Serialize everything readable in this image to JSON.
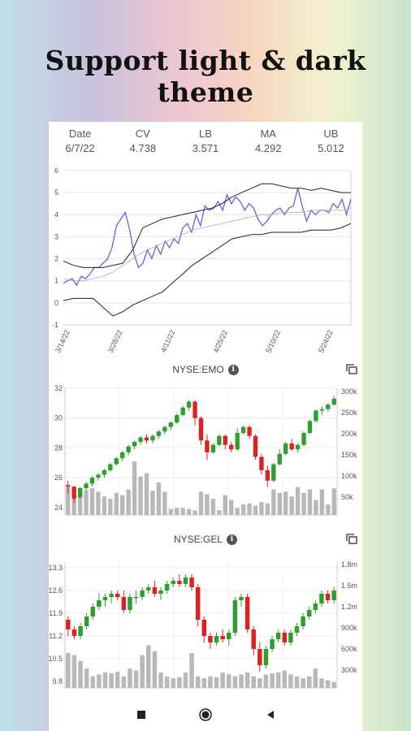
{
  "headline": "Support light & dark theme",
  "stats": [
    {
      "label": "Date",
      "value": "6/7/22"
    },
    {
      "label": "CV",
      "value": "4.738"
    },
    {
      "label": "LB",
      "value": "3.571"
    },
    {
      "label": "MA",
      "value": "4.292"
    },
    {
      "label": "UB",
      "value": "5.012"
    }
  ],
  "charts": {
    "emo_title": "NYSE:EMO",
    "gel_title": "NYSE:GEL"
  },
  "colors": {
    "up": "#2e9e2e",
    "down": "#e02020",
    "volume": "#b8b8b8",
    "cv": "#6a5fd8",
    "bands": "#222222",
    "ma": "#aaaaaa"
  },
  "icons": {
    "info": "info-icon",
    "copy": "copy-icon",
    "stop": "stop-icon",
    "home": "home-icon",
    "back": "back-icon"
  },
  "chart_data": [
    {
      "type": "line",
      "title": "",
      "x": [
        "3/14/22",
        "3/28/22",
        "4/11/22",
        "4/25/22",
        "5/10/22",
        "5/24/22"
      ],
      "ylim": [
        -1,
        6
      ],
      "yticks": [
        "6",
        "5",
        "4",
        "3",
        "2",
        "1",
        "0",
        "-1"
      ],
      "series": [
        {
          "name": "CV",
          "values": [
            0.9,
            1.0,
            1.1,
            0.8,
            1.2,
            1.1,
            1.3,
            1.6,
            1.6,
            1.8,
            2.0,
            2.5,
            3.5,
            3.8,
            4.1,
            3.3,
            2.2,
            1.6,
            1.8,
            2.4,
            2.0,
            2.6,
            2.2,
            2.8,
            2.5,
            2.9,
            2.7,
            3.4,
            3.6,
            3.2,
            4.0,
            3.5,
            4.4,
            4.2,
            4.3,
            4.6,
            4.2,
            4.9,
            4.5,
            4.8,
            4.6,
            4.2,
            4.5,
            4.3,
            3.8,
            3.5,
            3.7,
            4.0,
            4.2,
            4.3,
            4.0,
            4.3,
            4.4,
            5.2,
            4.4,
            3.7,
            4.2,
            4.0,
            4.2,
            4.2,
            4.1,
            4.5,
            4.3,
            4.7,
            4.0,
            4.7
          ]
        },
        {
          "name": "UB",
          "values": [
            1.9,
            1.7,
            1.6,
            1.6,
            1.6,
            1.7,
            1.8,
            2.4,
            3.4,
            3.6,
            3.8,
            3.9,
            4.0,
            4.1,
            4.2,
            4.3,
            4.5,
            4.8,
            5.0,
            5.2,
            5.4,
            5.4,
            5.3,
            5.2,
            5.2,
            5.1,
            5.2,
            5.1,
            5.0,
            5.0
          ]
        },
        {
          "name": "MA",
          "values": [
            1.1,
            1.0,
            1.0,
            1.1,
            1.2,
            1.4,
            1.7,
            2.0,
            2.3,
            2.5,
            2.7,
            2.9,
            3.1,
            3.3,
            3.4,
            3.5,
            3.6,
            3.7,
            3.8,
            3.9,
            4.0,
            4.0,
            4.1,
            4.1,
            4.1,
            4.2,
            4.2,
            4.2,
            4.2,
            4.3
          ]
        },
        {
          "name": "LB",
          "values": [
            0.1,
            0.2,
            0.2,
            0.2,
            -0.2,
            -0.6,
            -0.4,
            -0.1,
            0.1,
            0.3,
            0.5,
            0.9,
            1.3,
            1.7,
            2.0,
            2.3,
            2.6,
            2.9,
            3.0,
            3.1,
            3.1,
            3.2,
            3.2,
            3.2,
            3.2,
            3.3,
            3.3,
            3.3,
            3.4,
            3.6
          ]
        }
      ]
    },
    {
      "type": "bar",
      "title": "NYSE:EMO",
      "yticks_left": [
        "32",
        "30",
        "28",
        "26",
        "24"
      ],
      "yticks_right": [
        "300k",
        "250k",
        "200k",
        "150k",
        "100k",
        "50k"
      ],
      "ylim": [
        23.5,
        32
      ],
      "vol_lim": [
        0,
        300000
      ],
      "candles": [
        [
          25.5,
          25.8,
          24.9,
          25.4
        ],
        [
          25.4,
          25.4,
          24.3,
          24.6
        ],
        [
          24.7,
          25.4,
          24.6,
          25.3
        ],
        [
          25.3,
          25.7,
          25.1,
          25.6
        ],
        [
          25.6,
          26.1,
          25.4,
          26.0
        ],
        [
          26.0,
          26.3,
          25.8,
          26.2
        ],
        [
          26.2,
          26.6,
          26.0,
          26.5
        ],
        [
          26.5,
          27.0,
          26.4,
          26.9
        ],
        [
          26.9,
          27.4,
          26.8,
          27.3
        ],
        [
          27.3,
          27.8,
          27.1,
          27.7
        ],
        [
          27.7,
          28.2,
          27.5,
          28.1
        ],
        [
          28.1,
          28.5,
          27.9,
          28.4
        ],
        [
          28.4,
          28.8,
          28.2,
          28.7
        ],
        [
          28.7,
          28.9,
          28.3,
          28.5
        ],
        [
          28.5,
          28.9,
          28.3,
          28.8
        ],
        [
          28.8,
          29.2,
          28.6,
          29.1
        ],
        [
          29.1,
          29.5,
          28.9,
          29.4
        ],
        [
          29.4,
          29.8,
          29.2,
          29.7
        ],
        [
          29.7,
          30.3,
          29.6,
          30.2
        ],
        [
          30.2,
          30.8,
          30.1,
          30.7
        ],
        [
          30.7,
          31.2,
          30.5,
          31.1
        ],
        [
          31.1,
          31.2,
          29.5,
          30.0
        ],
        [
          30.0,
          30.1,
          28.2,
          28.5
        ],
        [
          28.5,
          28.9,
          27.2,
          27.7
        ],
        [
          27.7,
          28.3,
          27.6,
          28.2
        ],
        [
          28.2,
          28.9,
          28.1,
          28.8
        ],
        [
          28.8,
          28.9,
          27.9,
          28.2
        ],
        [
          28.2,
          28.4,
          27.7,
          27.9
        ],
        [
          27.9,
          29.3,
          27.8,
          29.0
        ],
        [
          29.0,
          29.5,
          28.9,
          29.4
        ],
        [
          29.4,
          29.5,
          28.6,
          28.8
        ],
        [
          28.8,
          28.9,
          27.2,
          27.4
        ],
        [
          27.4,
          27.6,
          26.2,
          26.5
        ],
        [
          26.5,
          26.8,
          25.4,
          25.8
        ],
        [
          25.8,
          27.0,
          25.7,
          26.9
        ],
        [
          26.9,
          27.9,
          26.8,
          27.6
        ],
        [
          27.6,
          28.4,
          27.5,
          28.3
        ],
        [
          28.3,
          28.6,
          27.8,
          27.9
        ],
        [
          27.9,
          28.3,
          27.7,
          28.2
        ],
        [
          28.2,
          29.1,
          28.1,
          29.0
        ],
        [
          29.0,
          29.9,
          28.9,
          29.8
        ],
        [
          29.8,
          30.6,
          29.7,
          30.5
        ],
        [
          30.5,
          30.8,
          30.2,
          30.6
        ],
        [
          30.6,
          31.0,
          30.4,
          30.9
        ],
        [
          30.9,
          31.5,
          30.8,
          31.3
        ]
      ],
      "volumes": [
        120000,
        90000,
        110000,
        105000,
        115000,
        100000,
        80000,
        70000,
        95000,
        85000,
        110000,
        230000,
        165000,
        180000,
        105000,
        140000,
        100000,
        25000,
        30000,
        30000,
        25000,
        20000,
        100000,
        90000,
        70000,
        20000,
        85000,
        65000,
        30000,
        45000,
        50000,
        40000,
        55000,
        50000,
        110000,
        95000,
        100000,
        80000,
        120000,
        95000,
        110000,
        65000,
        110000,
        45000,
        115000
      ]
    },
    {
      "type": "bar",
      "title": "NYSE:GEL",
      "yticks_left": [
        "13.3",
        "12.6",
        "11.9",
        "11.2",
        "10.5",
        "9.8"
      ],
      "yticks_right": [
        "1.8m",
        "1.5m",
        "1.2m",
        "900k",
        "600k",
        "300k"
      ],
      "ylim": [
        9.6,
        13.5
      ],
      "vol_lim": [
        0,
        1800000
      ],
      "candles": [
        [
          11.7,
          11.8,
          11.2,
          11.4
        ],
        [
          11.4,
          11.5,
          11.1,
          11.2
        ],
        [
          11.2,
          11.6,
          11.1,
          11.5
        ],
        [
          11.5,
          11.9,
          11.4,
          11.8
        ],
        [
          11.8,
          12.2,
          11.7,
          12.1
        ],
        [
          12.1,
          12.5,
          12.0,
          12.3
        ],
        [
          12.3,
          12.5,
          12.1,
          12.4
        ],
        [
          12.4,
          12.6,
          12.2,
          12.5
        ],
        [
          12.5,
          12.6,
          12.3,
          12.4
        ],
        [
          12.4,
          12.6,
          11.9,
          12.0
        ],
        [
          12.0,
          12.5,
          11.9,
          12.4
        ],
        [
          12.4,
          12.6,
          12.2,
          12.4
        ],
        [
          12.4,
          12.7,
          12.3,
          12.6
        ],
        [
          12.6,
          12.8,
          12.5,
          12.7
        ],
        [
          12.7,
          12.9,
          12.4,
          12.5
        ],
        [
          12.5,
          12.7,
          12.3,
          12.6
        ],
        [
          12.6,
          12.9,
          12.5,
          12.8
        ],
        [
          12.8,
          13.0,
          12.7,
          12.9
        ],
        [
          12.9,
          13.1,
          12.7,
          12.8
        ],
        [
          12.8,
          13.1,
          12.7,
          13.0
        ],
        [
          13.0,
          13.1,
          12.6,
          12.7
        ],
        [
          12.7,
          12.8,
          11.5,
          11.7
        ],
        [
          11.7,
          11.8,
          11.0,
          11.2
        ],
        [
          11.2,
          11.3,
          10.8,
          11.0
        ],
        [
          11.0,
          11.3,
          10.9,
          11.2
        ],
        [
          11.2,
          11.4,
          11.0,
          11.1
        ],
        [
          11.1,
          11.4,
          10.9,
          11.3
        ],
        [
          11.3,
          12.4,
          11.2,
          12.3
        ],
        [
          12.3,
          12.5,
          12.1,
          12.4
        ],
        [
          12.4,
          12.5,
          11.3,
          11.4
        ],
        [
          11.4,
          11.5,
          10.6,
          10.8
        ],
        [
          10.8,
          11.0,
          10.1,
          10.3
        ],
        [
          10.3,
          10.9,
          10.2,
          10.8
        ],
        [
          10.8,
          11.2,
          10.7,
          11.1
        ],
        [
          11.1,
          11.4,
          11.0,
          11.3
        ],
        [
          11.3,
          11.4,
          10.9,
          11.0
        ],
        [
          11.0,
          11.4,
          10.9,
          11.3
        ],
        [
          11.3,
          11.6,
          11.2,
          11.5
        ],
        [
          11.5,
          11.9,
          11.4,
          11.8
        ],
        [
          11.8,
          12.1,
          11.7,
          12.0
        ],
        [
          12.0,
          12.3,
          11.9,
          12.2
        ],
        [
          12.2,
          12.6,
          12.1,
          12.5
        ],
        [
          12.5,
          12.6,
          12.2,
          12.3
        ],
        [
          12.3,
          12.7,
          12.2,
          12.6
        ]
      ],
      "volumes": [
        900000,
        850000,
        700000,
        500000,
        300000,
        350000,
        400000,
        380000,
        420000,
        300000,
        500000,
        450000,
        850000,
        1100000,
        950000,
        400000,
        300000,
        250000,
        280000,
        400000,
        900000,
        300000,
        250000,
        300000,
        280000,
        400000,
        350000,
        300000,
        350000,
        400000,
        300000,
        250000,
        350000,
        380000,
        400000,
        450000,
        350000,
        300000,
        250000,
        300000,
        500000,
        250000,
        200000,
        150000
      ]
    }
  ]
}
